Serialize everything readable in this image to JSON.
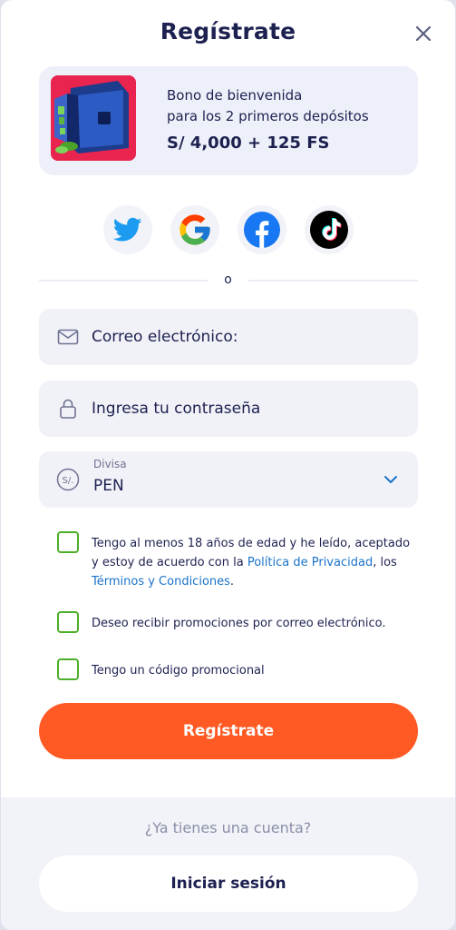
{
  "header": {
    "title": "Regístrate",
    "close_icon": "close-icon"
  },
  "bonus": {
    "image": "safe-with-money-illustration",
    "line1": "Bono de bienvenida",
    "line2": "para los 2 primeros depósitos",
    "amount": "S/ 4,000 + 125 FS"
  },
  "socials": [
    {
      "name": "twitter",
      "icon": "twitter-icon"
    },
    {
      "name": "google",
      "icon": "google-icon"
    },
    {
      "name": "facebook",
      "icon": "facebook-icon"
    },
    {
      "name": "tiktok",
      "icon": "tiktok-icon"
    }
  ],
  "divider": {
    "text": "o"
  },
  "form": {
    "email": {
      "placeholder": "Correo electrónico:",
      "value": "",
      "icon": "envelope-icon"
    },
    "password": {
      "placeholder": "Ingresa tu contraseña",
      "value": "",
      "icon": "lock-icon"
    },
    "currency": {
      "label": "Divisa",
      "value": "PEN",
      "icon": "currency-sol-icon"
    }
  },
  "checkboxes": {
    "terms": {
      "text_before": "Tengo al menos 18 años de edad y he leído, aceptado y estoy de acuerdo con la ",
      "privacy_link": "Política de Privacidad",
      "text_middle": ", los ",
      "terms_link": "Términos y Condiciones",
      "text_after": ".",
      "checked": false
    },
    "promotions": {
      "text": "Deseo recibir promociones por correo electrónico.",
      "checked": false
    },
    "promo_code": {
      "text": "Tengo un código promocional",
      "checked": false
    }
  },
  "register_button": "Regístrate",
  "footer": {
    "have_account": "¿Ya tienes una cuenta?",
    "login_button": "Iniciar sesión"
  },
  "colors": {
    "accent": "#ff5a24",
    "checkbox_border": "#4caf2a",
    "link": "#1a73c9",
    "title": "#1d2150",
    "field_bg": "#f1f2f8"
  }
}
